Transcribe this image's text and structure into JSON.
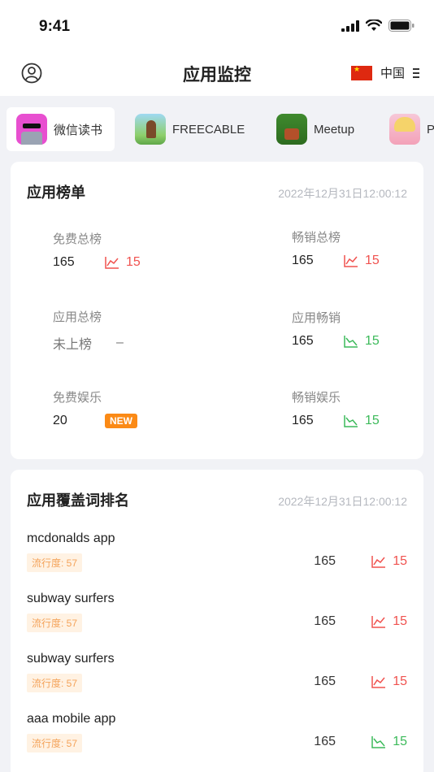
{
  "status": {
    "time": "9:41"
  },
  "nav": {
    "title": "应用监控",
    "country": "中国"
  },
  "apps": [
    {
      "name": "微信读书",
      "icon": "weread-app-icon"
    },
    {
      "name": "FREECABLE",
      "icon": "freecable-app-icon"
    },
    {
      "name": "Meetup",
      "icon": "meetup-app-icon"
    },
    {
      "name": "P",
      "icon": "anime-game-app-icon"
    }
  ],
  "rankings": {
    "title": "应用榜单",
    "timestamp": "2022年12月31日12:00:12",
    "items": [
      {
        "label": "免费总榜",
        "value": "165",
        "change": "15",
        "trend": "up"
      },
      {
        "label": "畅销总榜",
        "value": "165",
        "change": "15",
        "trend": "up"
      },
      {
        "label": "应用总榜",
        "value": "未上榜",
        "change": "–",
        "trend": "none"
      },
      {
        "label": "应用畅销",
        "value": "165",
        "change": "15",
        "trend": "down"
      },
      {
        "label": "免费娱乐",
        "value": "20",
        "change": "NEW",
        "trend": "new"
      },
      {
        "label": "畅销娱乐",
        "value": "165",
        "change": "15",
        "trend": "down"
      }
    ]
  },
  "keywords": {
    "title": "应用覆盖词排名",
    "timestamp": "2022年12月31日12:00:12",
    "items": [
      {
        "name": "mcdonalds app",
        "popularity": "流行度: 57",
        "rank": "165",
        "change": "15",
        "trend": "up"
      },
      {
        "name": "subway surfers",
        "popularity": "流行度: 57",
        "rank": "165",
        "change": "15",
        "trend": "up"
      },
      {
        "name": "subway surfers",
        "popularity": "流行度: 57",
        "rank": "165",
        "change": "15",
        "trend": "up"
      },
      {
        "name": "aaa mobile app",
        "popularity": "流行度: 57",
        "rank": "165",
        "change": "15",
        "trend": "down"
      }
    ]
  },
  "colors": {
    "up": "#f0524f",
    "down": "#3cba5a",
    "new_badge": "#fb8a16",
    "popularity_bg": "#fff2e3"
  }
}
